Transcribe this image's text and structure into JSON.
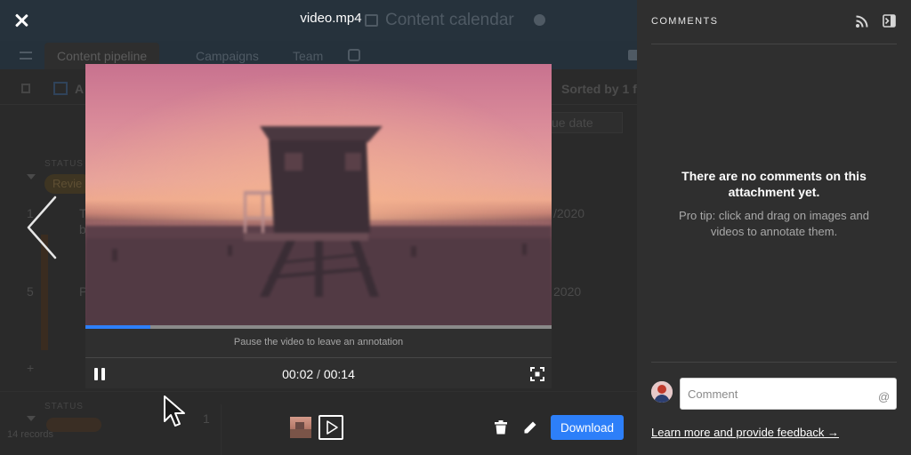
{
  "lightbox": {
    "filename": "video.mp4",
    "close_icon": "close-icon",
    "prev_icon": "chevron-left-icon"
  },
  "background_app": {
    "base_title": "Content calendar",
    "tabs": [
      "Content pipeline",
      "Campaigns",
      "Team"
    ],
    "view_name_fragment": "A",
    "sort_text": "Sorted by 1 fi",
    "column_header": "ue date",
    "group_label": "STATUS",
    "group_value": "Revie",
    "row1_num": "1",
    "row1_text": "T",
    "row1_text2": "b",
    "row1_date": "/2020",
    "row2_num": "5",
    "row2_text": "P",
    "row2_date": "2020",
    "group2_label": "STATUS",
    "group2_count": "1",
    "records": "14 records"
  },
  "player": {
    "annotation_hint": "Pause the video to leave an annotation",
    "current_time": "00:02",
    "separator": "/",
    "duration": "00:14",
    "progress": 0.14,
    "pause_icon": "pause-icon",
    "fullscreen_icon": "fullscreen-icon"
  },
  "toolbar": {
    "thumbnail_icon": "image-thumbnail-icon",
    "video_thumbnail_icon": "play-icon",
    "delete_icon": "trash-icon",
    "edit_icon": "pencil-icon",
    "download_label": "Download"
  },
  "comments": {
    "title": "COMMENTS",
    "rss_icon": "rss-icon",
    "collapse_icon": "collapse-panel-icon",
    "empty_title": "There are no comments on this attachment yet.",
    "empty_tip": "Pro tip: click and drag on images and videos to annotate them.",
    "input_placeholder": "Comment",
    "mention_symbol": "@",
    "feedback_link": "Learn more and provide feedback →"
  },
  "colors": {
    "accent": "#2d7ff9",
    "panel_bg": "#2f2f2f",
    "overlay_bg": "#1c1c1c"
  }
}
